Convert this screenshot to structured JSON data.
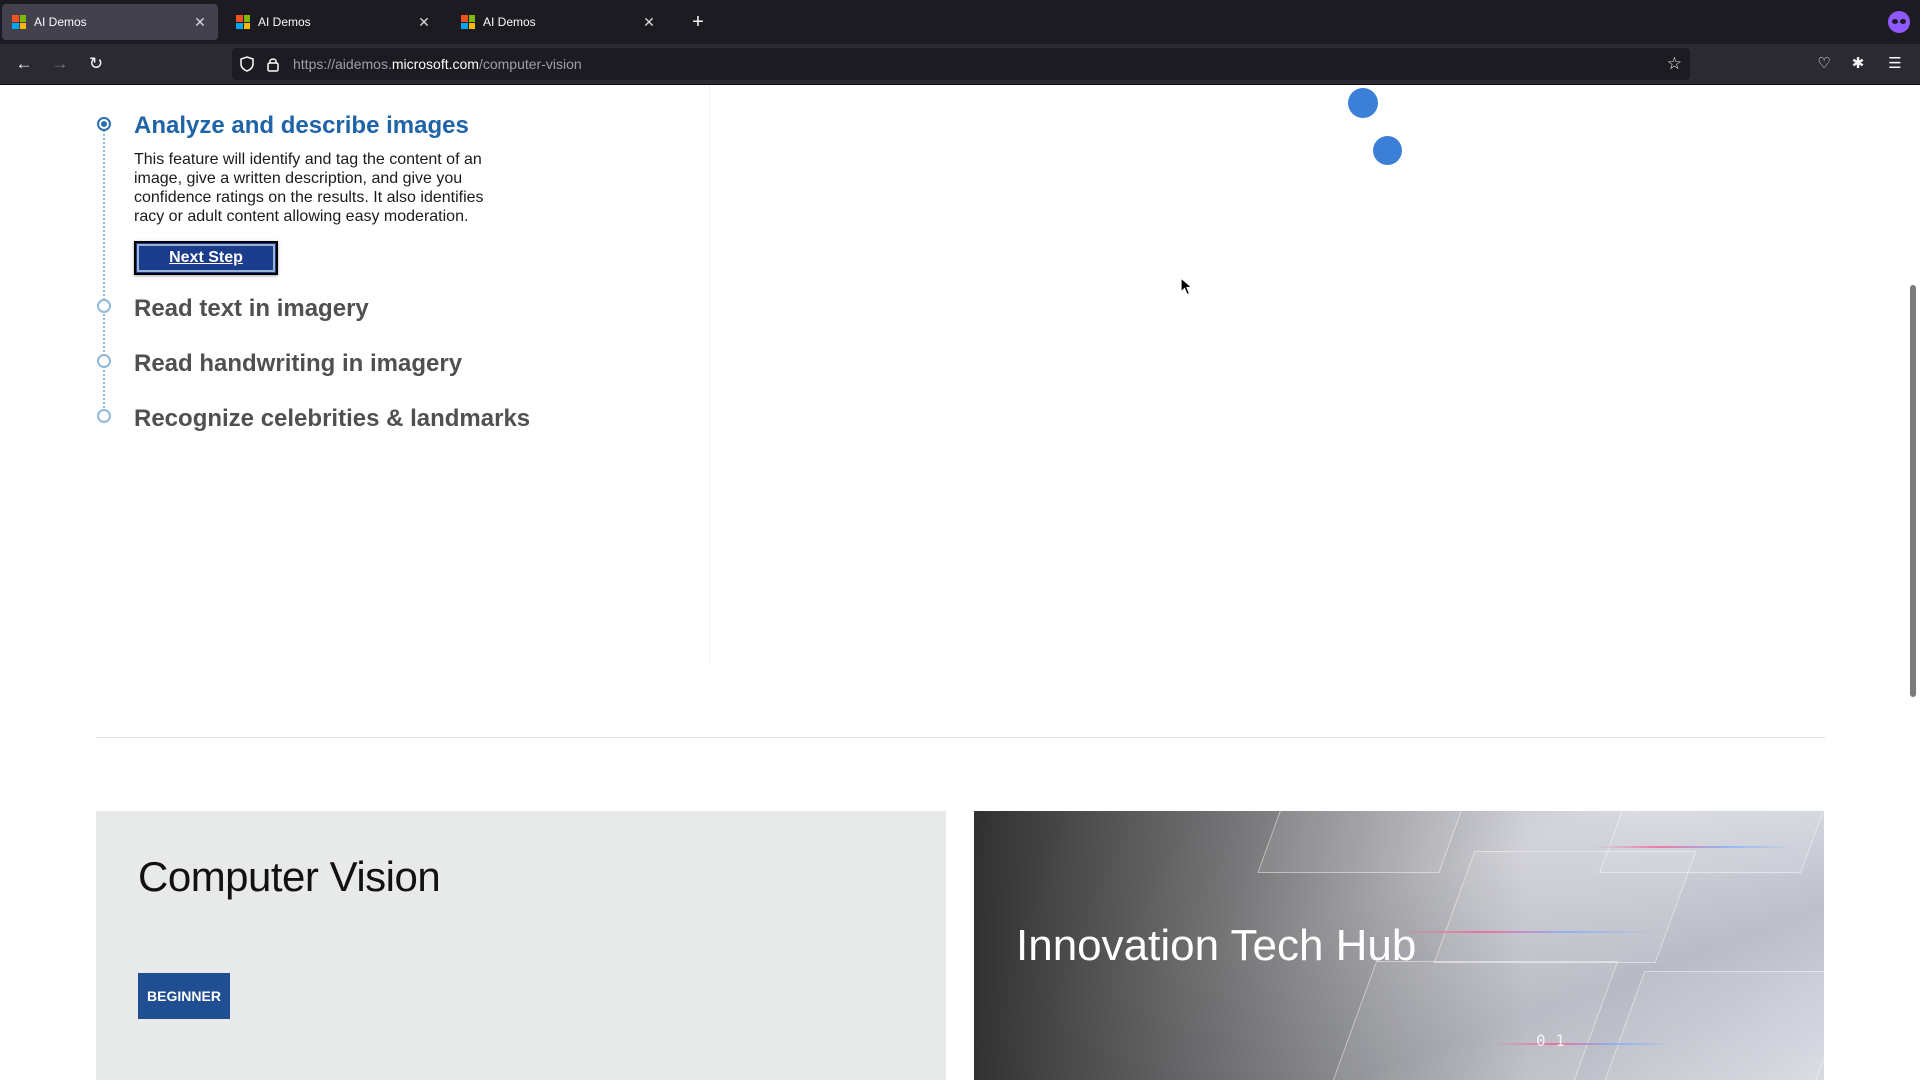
{
  "browser": {
    "tabs": [
      {
        "title": "AI Demos",
        "active": true
      },
      {
        "title": "AI Demos",
        "active": false
      },
      {
        "title": "AI Demos",
        "active": false
      }
    ],
    "new_tab_icon": "plus-icon",
    "url": {
      "prefix": "https://aidemos.",
      "host": "microsoft.com",
      "path": "/computer-vision"
    }
  },
  "steps": {
    "cropped_heading": "y",
    "items": [
      {
        "title": "Analyze and describe images",
        "active": true
      },
      {
        "title": "Read text in imagery",
        "active": false
      },
      {
        "title": "Read handwriting in imagery",
        "active": false
      },
      {
        "title": "Recognize celebrities & landmarks",
        "active": false
      }
    ],
    "description": "This feature will identify and tag the content of an image, give a written description, and give you confidence ratings on the results. It also identifies racy or adult content allowing easy moderation.",
    "next_button": "Next Step"
  },
  "cards": {
    "left": {
      "title": "Computer Vision",
      "badge": "BEGINNER"
    },
    "right": {
      "title": "Innovation Tech Hub",
      "overlay_digits": "0 1"
    }
  },
  "colors": {
    "accent": "#1f63a8",
    "button": "#1b3c8a",
    "badge": "#1f4e93",
    "dot": "#3b7fd6",
    "tabbar": "#1c1b22",
    "navbar": "#2b2a33"
  }
}
